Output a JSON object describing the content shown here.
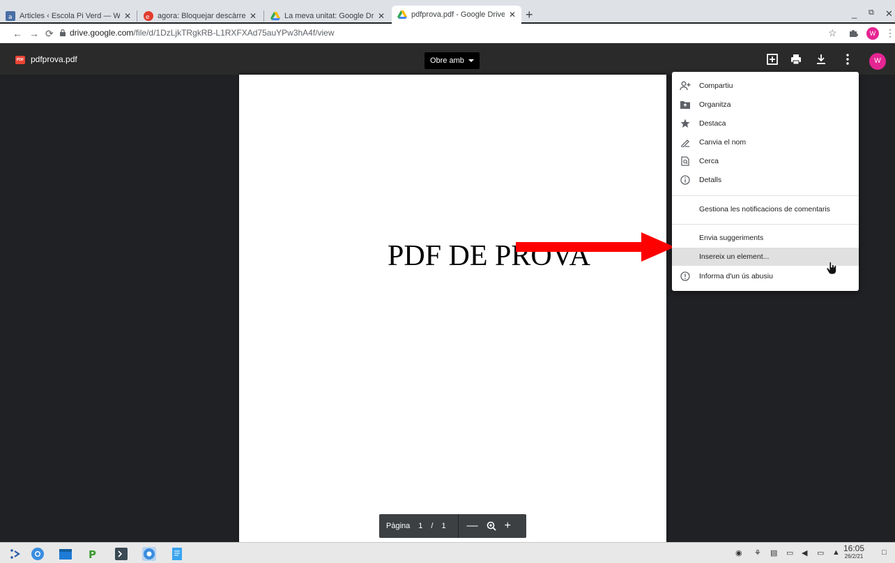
{
  "tabs": [
    {
      "title": "Articles ‹ Escola Pi Verd — Wo",
      "active": false
    },
    {
      "title": "agora: Bloquejar descàrrega",
      "active": false
    },
    {
      "title": "La meva unitat: Google Drive",
      "active": false
    },
    {
      "title": "pdfprova.pdf - Google Drive",
      "active": true
    }
  ],
  "address": {
    "host": "drive.google.com",
    "path": "/file/d/1DzLjkTRgkRB-L1RXFXAd75auYPw3hA4f/view"
  },
  "profile_initial": "W",
  "viewer": {
    "file_badge": "PDF",
    "filename": "pdfprova.pdf",
    "open_with": "Obre amb",
    "page_text": "PDF DE PROVA"
  },
  "menu": {
    "items": [
      {
        "label": "Compartiu",
        "icon": "share-person-icon"
      },
      {
        "label": "Organitza",
        "icon": "folder-move-icon"
      },
      {
        "label": "Destaca",
        "icon": "star-icon"
      },
      {
        "label": "Canvia el nom",
        "icon": "pencil-icon"
      },
      {
        "label": "Cerca",
        "icon": "find-in-page-icon"
      },
      {
        "label": "Detalls",
        "icon": "info-icon"
      }
    ],
    "notifications": "Gestiona les notificacions de comentaris",
    "feedback": "Envia suggeriments",
    "embed": "Insereix un element...",
    "report": "Informa d'un ús abusiu"
  },
  "pagebar": {
    "label": "Pàgina",
    "current": "1",
    "separator": "/",
    "total": "1"
  },
  "clock": {
    "time": "16:05",
    "date": "26/2/21"
  },
  "colors": {
    "accent_red": "#ff0000",
    "avatar": "#e52592",
    "viewer_bg": "#202124"
  }
}
